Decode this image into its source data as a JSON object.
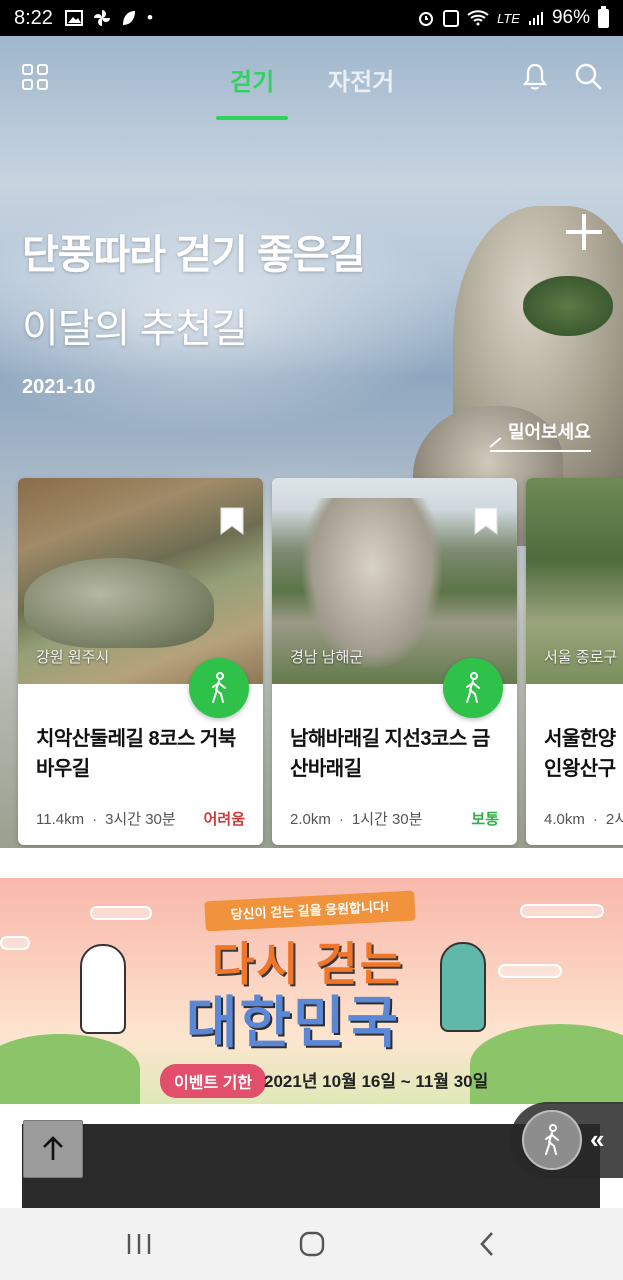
{
  "status_bar": {
    "time": "8:22",
    "network": "LTE",
    "battery": "96%"
  },
  "top_nav": {
    "tabs": [
      {
        "label": "걷기",
        "active": true
      },
      {
        "label": "자전거",
        "active": false
      }
    ],
    "accent_color": "#2fd35c"
  },
  "hero": {
    "title": "단풍따라 걷기 좋은길",
    "subtitle": "이달의 추천길",
    "date": "2021-10",
    "swipe_hint": "밀어보세요"
  },
  "cards": [
    {
      "region": "강원 원주시",
      "name": "치악산둘레길 8코스 거북바우길",
      "distance": "11.4km",
      "duration": "3시간 30분",
      "level": "어려움",
      "level_color": "#d03a3a"
    },
    {
      "region": "경남 남해군",
      "name": "남해바래길 지선3코스 금산바래길",
      "distance": "2.0km",
      "duration": "1시간 30분",
      "level": "보통",
      "level_color": "#2fb04a"
    },
    {
      "region": "서울 종로구",
      "name": "서울한양 인왕산구",
      "distance": "4.0km",
      "duration": "2시",
      "level": ""
    }
  ],
  "banner": {
    "ribbon": "당신이 걷는 길을 응원합니다!",
    "title_line1": "다시 걷는",
    "title_line2": "대한민국",
    "period_label": "이벤트 기한",
    "period": "2021년 10월 16일 ~ 11월 30일"
  },
  "icons": {
    "menu": "grid-icon",
    "bell": "bell-icon",
    "search": "search-icon",
    "bookmark": "bookmark-icon",
    "walk": "walking-person-icon",
    "scroll_top": "arrow-up-icon",
    "collapse": "double-chevron-left-icon"
  }
}
